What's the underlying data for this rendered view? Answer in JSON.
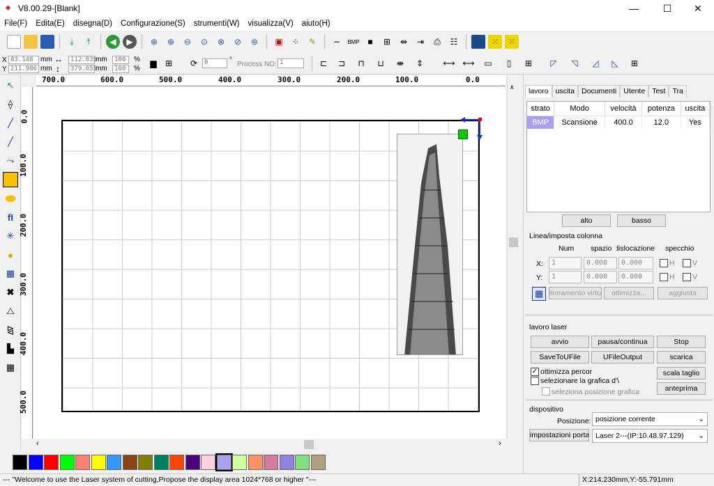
{
  "app": {
    "title": "V8.00.29-[Blank]"
  },
  "window_controls": {
    "minimize": "—",
    "maximize": "☐",
    "close": "✕"
  },
  "menu": [
    "File(F)",
    "Edita(E)",
    "disegna(D)",
    "Configurazione(S)",
    "strumenti(W)",
    "visualizza(V)",
    "aiuto(H)"
  ],
  "coords": {
    "x_label": "X",
    "x_value": "83.148",
    "x_unit": "mm",
    "y_label": "Y",
    "y_value": "211.986",
    "y_unit": "mm",
    "w_value": "112.835",
    "w_unit": "mm",
    "h_value": "379.055",
    "h_unit": "mm",
    "sx_value": "100",
    "sy_value": "100",
    "pct": "%",
    "angle_value": "0",
    "deg": "°",
    "process_label": "Process NO:",
    "process_value": "1"
  },
  "ruler_h": [
    "700.0",
    "600.0",
    "500.0",
    "400.0",
    "300.0",
    "200.0",
    "100.0",
    "0.0"
  ],
  "ruler_v": [
    "0.0",
    "100.0",
    "200.0",
    "300.0",
    "400.0",
    "500.0"
  ],
  "bmp_label": "BMP",
  "palette": {
    "colors": [
      "#000000",
      "#0000ff",
      "#ff0000",
      "#00ff00",
      "#fa8072",
      "#ffff00",
      "#3399ff",
      "#8b4513",
      "#808000",
      "#008060",
      "#ff4500",
      "#4b0082",
      "#ffd0e0",
      "#a8a0f0",
      "#d0ffa0",
      "#ff9060",
      "#d47aa0",
      "#9080e0",
      "#80e080",
      "#b0a080"
    ]
  },
  "status": {
    "message": "--- \"Welcome to use the Laser system of cutting,Propose the display area 1024*768 or higher \"---",
    "coords": "X:214.230mm,Y:-55.791mm"
  },
  "right_panel": {
    "tabs": [
      "lavoro",
      "uscita",
      "Documenti",
      "Utente",
      "Test",
      "Tra"
    ],
    "layer_table": {
      "headers": [
        "strato",
        "Modo",
        "velocità",
        "potenza",
        "uscita"
      ],
      "rows": [
        {
          "layer": "BMP",
          "mode": "Scansione",
          "speed": "400.0",
          "power": "12.0",
          "out": "Yes"
        }
      ]
    },
    "up_btn": "alto",
    "down_btn": "basso",
    "array": {
      "title": "Linea/imposta colonna",
      "h_num": "Num",
      "h_space": "spazio",
      "h_disloc": "dislocazione",
      "h_mirror": "specchio",
      "x_label": "X:",
      "x_num": "1",
      "x_space": "0.000",
      "x_disloc": "0.000",
      "y_label": "Y:",
      "y_num": "1",
      "y_space": "0.000",
      "y_disloc": "0.000",
      "h": "H",
      "v": "V",
      "virtual_btn": "allineamento virtu",
      "optimize_btn": "ottimizza...",
      "adjust_btn": "aggiusta"
    },
    "laser": {
      "title": "lavoro laser",
      "start": "avvio",
      "pause": "pausa/continua",
      "stop": "Stop",
      "save_u": "SaveToUFile",
      "u_output": "UFileOutput",
      "download": "scarica",
      "opt_path": "ottimizza percor",
      "select_graphic": "selezionare la grafica d'\\",
      "select_pos": "seleziona posizione grafica",
      "scale": "scala taglio",
      "preview": "anteprima"
    },
    "device": {
      "title": "dispositivo",
      "pos_label": "Posizione:",
      "pos_value": "posizione corrente",
      "port_btn": "impostazioni porta",
      "laser_value": "Laser 2---(IP:10.48.97.129)"
    }
  }
}
